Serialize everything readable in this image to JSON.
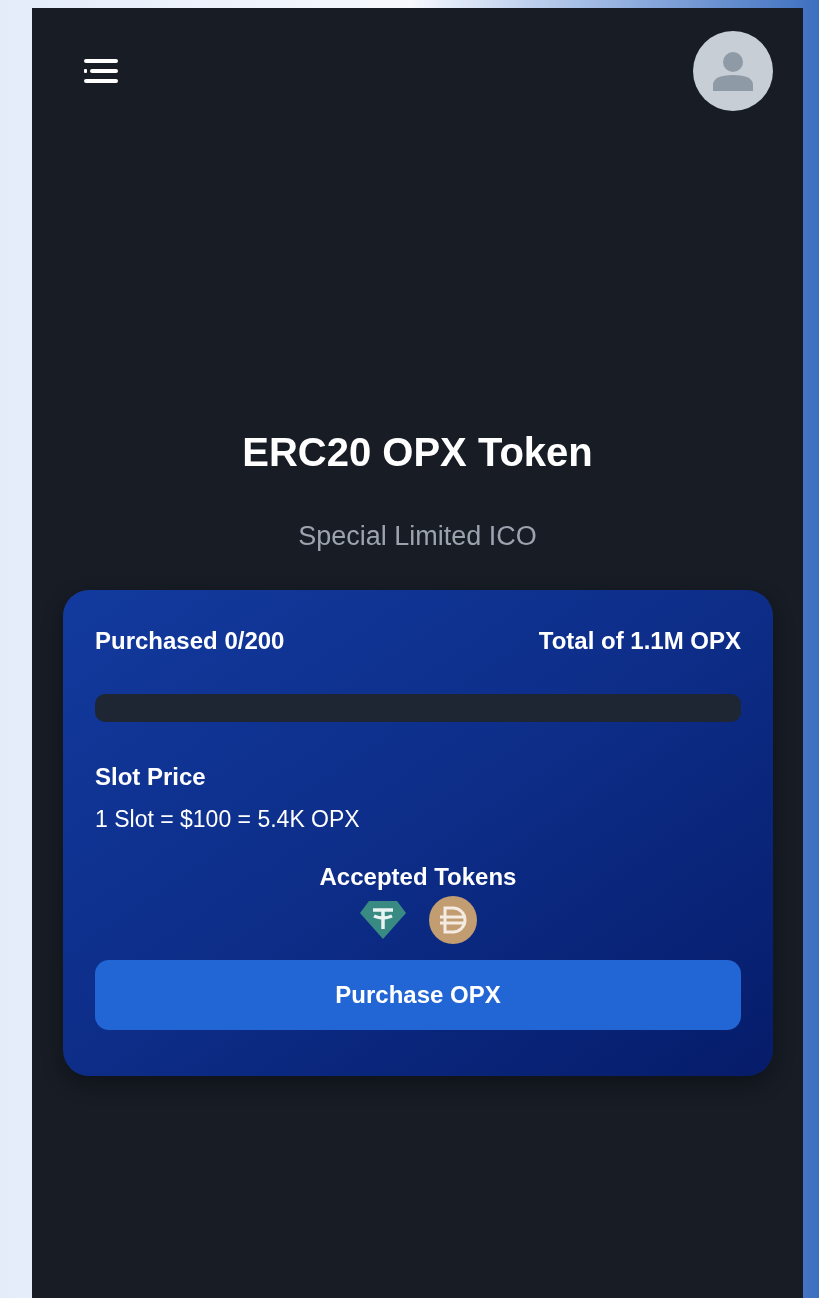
{
  "hero": {
    "title": "ERC20 OPX Token",
    "subtitle": "Special Limited ICO"
  },
  "card": {
    "purchased": "Purchased 0/200",
    "total": "Total of 1.1M OPX",
    "progress": {
      "level": 0
    },
    "slot_label": "Slot Price",
    "slot_price": "1 Slot = $100 = 5.4K OPX",
    "tokens_label": "Accepted Tokens",
    "tokens": [
      {
        "kind": "tether"
      },
      {
        "kind": "dai"
      }
    ],
    "button": "Purchase OPX"
  }
}
